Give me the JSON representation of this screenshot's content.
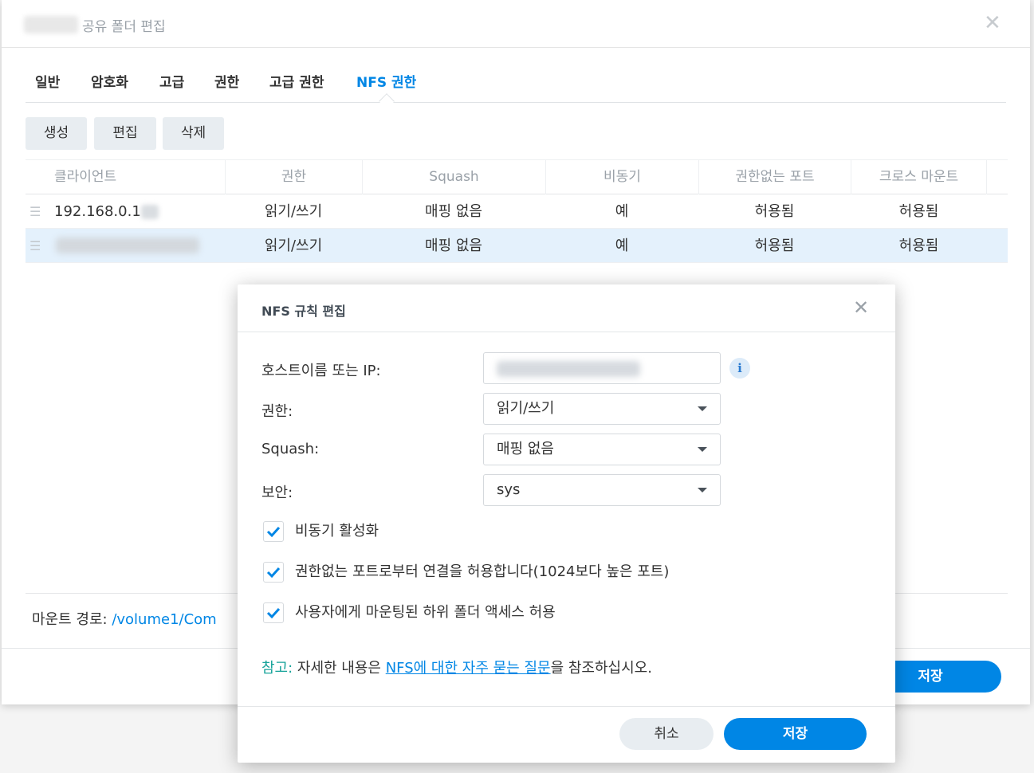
{
  "window": {
    "title": "공유 폴더 편집",
    "close_symbol": "✕"
  },
  "tabs": [
    {
      "label": "일반",
      "active": false
    },
    {
      "label": "암호화",
      "active": false
    },
    {
      "label": "고급",
      "active": false
    },
    {
      "label": "권한",
      "active": false
    },
    {
      "label": "고급 권한",
      "active": false
    },
    {
      "label": "NFS 권한",
      "active": true
    }
  ],
  "toolbar": {
    "create_label": "생성",
    "edit_label": "편집",
    "delete_label": "삭제"
  },
  "grid": {
    "columns": [
      "클라이언트",
      "권한",
      "Squash",
      "비동기",
      "권한없는 포트",
      "크로스 마운트"
    ],
    "rows": [
      {
        "client": "192.168.0.1",
        "permission": "읽기/쓰기",
        "squash": "매핑 없음",
        "async": "예",
        "non_privileged_port": "허용됨",
        "cross_mount": "허용됨",
        "selected": false
      },
      {
        "client": "",
        "permission": "읽기/쓰기",
        "squash": "매핑 없음",
        "async": "예",
        "non_privileged_port": "허용됨",
        "cross_mount": "허용됨",
        "selected": true
      }
    ]
  },
  "mount": {
    "label": "마운트 경로:",
    "path": "/volume1/Com"
  },
  "window_footer": {
    "save_label": "저장"
  },
  "modal": {
    "title": "NFS 규칙 편집",
    "close_symbol": "✕",
    "host_label": "호스트이름 또는 IP:",
    "permission_label": "권한:",
    "permission_value": "읽기/쓰기",
    "squash_label": "Squash:",
    "squash_value": "매핑 없음",
    "security_label": "보안:",
    "security_value": "sys",
    "info_symbol": "i",
    "checkboxes": [
      {
        "label": "비동기 활성화",
        "checked": true
      },
      {
        "label": "권한없는 포트로부터 연결을 허용합니다(1024보다 높은 포트)",
        "checked": true
      },
      {
        "label": "사용자에게 마운팅된 하위 폴더 액세스 허용",
        "checked": true
      }
    ],
    "note_key": "참고:",
    "note_prefix": " 자세한 내용은 ",
    "note_link": "NFS에 대한 자주 묻는 질문",
    "note_suffix": "을 참조하십시오.",
    "cancel_label": "취소",
    "save_label": "저장"
  },
  "colors": {
    "accent": "#0086e5",
    "selected_row": "#e4f1fc",
    "note_key": "#17a39a"
  }
}
